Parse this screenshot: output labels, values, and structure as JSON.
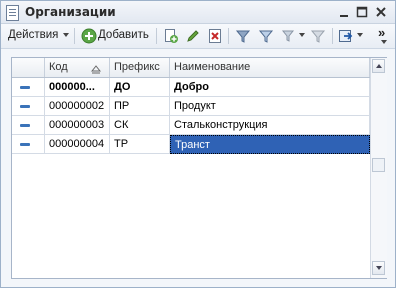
{
  "window": {
    "title": "Организации"
  },
  "titlebar_buttons": [
    "minimize",
    "maximize",
    "close"
  ],
  "toolbar": {
    "actions_label": "Действия",
    "add_label": "Добавить",
    "overflow_label": "»"
  },
  "table": {
    "columns": [
      "Код",
      "Префикс",
      "Наименование"
    ],
    "rows": [
      {
        "code": "000000...",
        "prefix": "ДО",
        "name": "Добро",
        "bold": true
      },
      {
        "code": "000000002",
        "prefix": "ПР",
        "name": "Продукт",
        "bold": false
      },
      {
        "code": "000000003",
        "prefix": "СК",
        "name": "Стальконструкция",
        "bold": false
      },
      {
        "code": "000000004",
        "prefix": "ТР",
        "name": "Транст",
        "bold": false,
        "selected": true
      }
    ]
  },
  "colors": {
    "selection": "#2f62b5",
    "marker": "#3b73b9",
    "title_bg": "#e2e8f1"
  }
}
